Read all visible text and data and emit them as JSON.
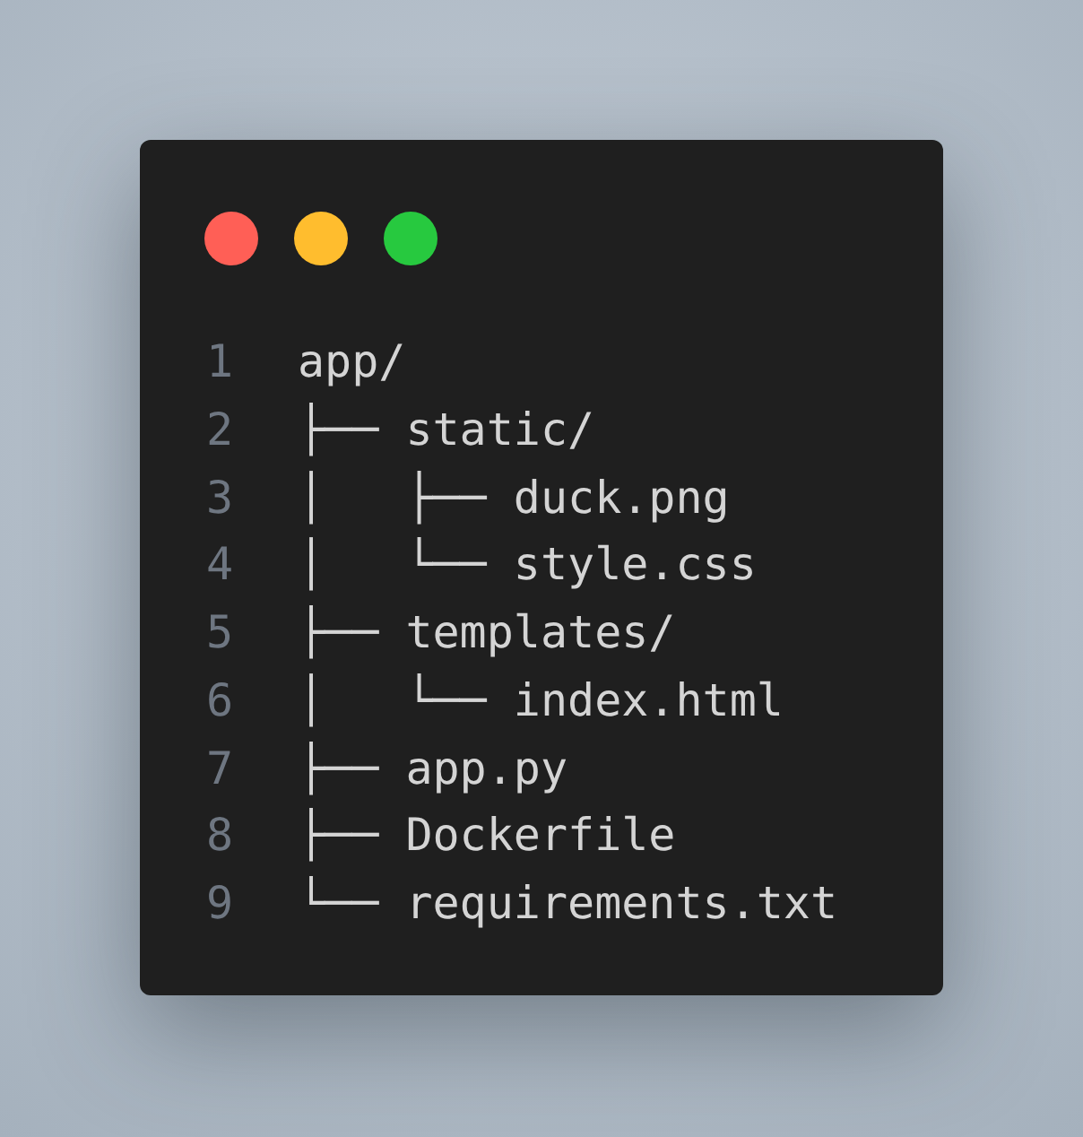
{
  "window": {
    "dots": [
      {
        "color": "#ff5f56"
      },
      {
        "color": "#ffbd2e"
      },
      {
        "color": "#27c93f"
      }
    ]
  },
  "code_lines": [
    {
      "number": "1",
      "text": "app/"
    },
    {
      "number": "2",
      "text": "├── static/"
    },
    {
      "number": "3",
      "text": "│   ├── duck.png"
    },
    {
      "number": "4",
      "text": "│   └── style.css"
    },
    {
      "number": "5",
      "text": "├── templates/"
    },
    {
      "number": "6",
      "text": "│   └── index.html"
    },
    {
      "number": "7",
      "text": "├── app.py"
    },
    {
      "number": "8",
      "text": "├── Dockerfile"
    },
    {
      "number": "9",
      "text": "└── requirements.txt"
    }
  ]
}
